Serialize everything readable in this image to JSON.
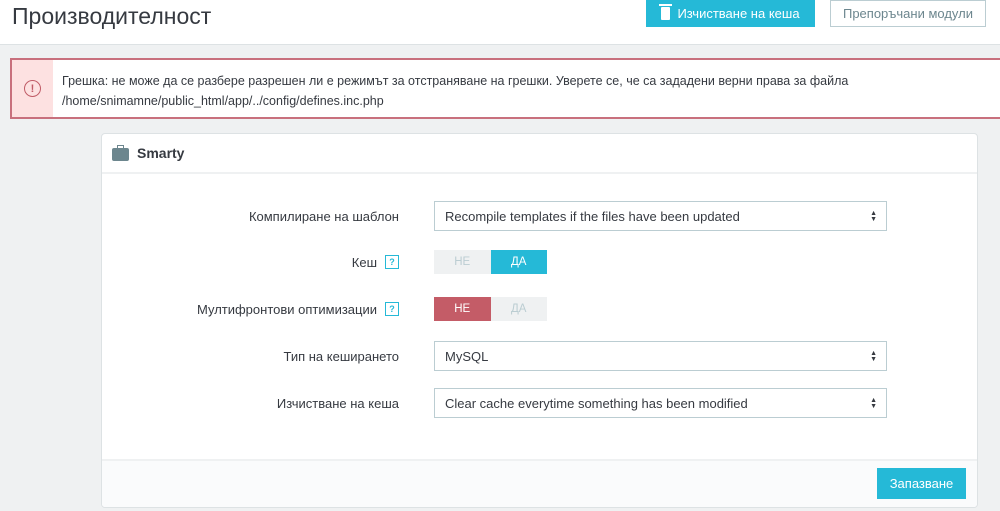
{
  "header": {
    "title": "Производителност",
    "clear_cache_label": "Изчистване на кеша",
    "recommended_label": "Препоръчани модули"
  },
  "alert": {
    "line1": "Грешка: не може да се разбере разрешен ли е режимът за отстраняване на грешки. Уверете се, че са зададени верни права за файла",
    "line2": "/home/snimamne/public_html/app/../config/defines.inc.php"
  },
  "panel": {
    "title": "Smarty",
    "fields": {
      "compile": {
        "label": "Компилиране на шаблон",
        "value": "Recompile templates if the files have been updated"
      },
      "cache": {
        "label": "Кеш",
        "no": "НЕ",
        "yes": "ДА",
        "selected": "ДА"
      },
      "multifront": {
        "label": "Мултифронтови оптимизации",
        "no": "НЕ",
        "yes": "ДА",
        "selected": "НЕ"
      },
      "cache_type": {
        "label": "Тип на кеширането",
        "value": "MySQL"
      },
      "clear_cache": {
        "label": "Изчистване на кеша",
        "value": "Clear cache everytime something has been modified"
      }
    },
    "save_label": "Запазване"
  },
  "help_glyph": "?",
  "colors": {
    "accent": "#25b9d7",
    "danger": "#c45c67"
  }
}
